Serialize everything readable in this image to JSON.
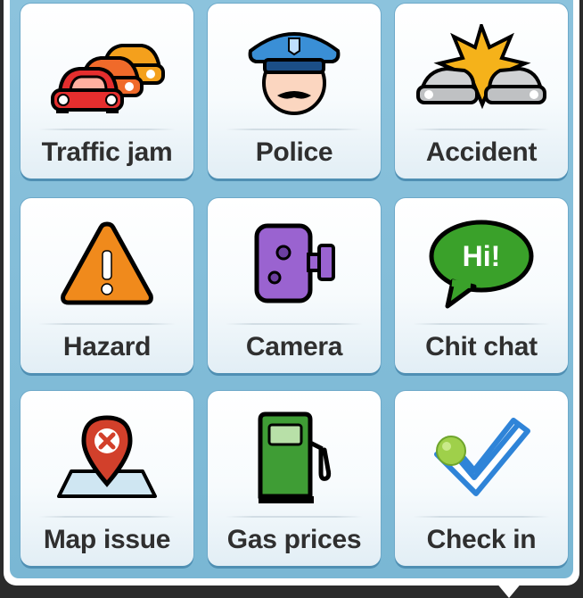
{
  "report_menu": {
    "items": [
      {
        "key": "traffic_jam",
        "label": "Traffic jam",
        "icon": "traffic-jam-icon"
      },
      {
        "key": "police",
        "label": "Police",
        "icon": "police-icon"
      },
      {
        "key": "accident",
        "label": "Accident",
        "icon": "accident-icon"
      },
      {
        "key": "hazard",
        "label": "Hazard",
        "icon": "hazard-icon"
      },
      {
        "key": "camera",
        "label": "Camera",
        "icon": "camera-icon"
      },
      {
        "key": "chit_chat",
        "label": "Chit chat",
        "icon": "chat-bubble-icon",
        "bubble_text": "Hi!"
      },
      {
        "key": "map_issue",
        "label": "Map issue",
        "icon": "map-pin-icon"
      },
      {
        "key": "gas_prices",
        "label": "Gas prices",
        "icon": "gas-pump-icon"
      },
      {
        "key": "check_in",
        "label": "Check in",
        "icon": "check-in-icon"
      }
    ]
  },
  "colors": {
    "panel_bg": "#8cc3dd",
    "tile_bg": "#ffffff",
    "label_text": "#2f2f2f",
    "traffic_red": "#e52e2e",
    "police_blue": "#3a8fd6",
    "accident_star": "#f5b21a",
    "hazard_orange": "#f08a1c",
    "camera_purple": "#9a63d0",
    "chat_green": "#3aa12a",
    "map_pin_red": "#d2402b",
    "gas_green": "#3f9d35",
    "checkin_blue": "#2f84d8"
  }
}
